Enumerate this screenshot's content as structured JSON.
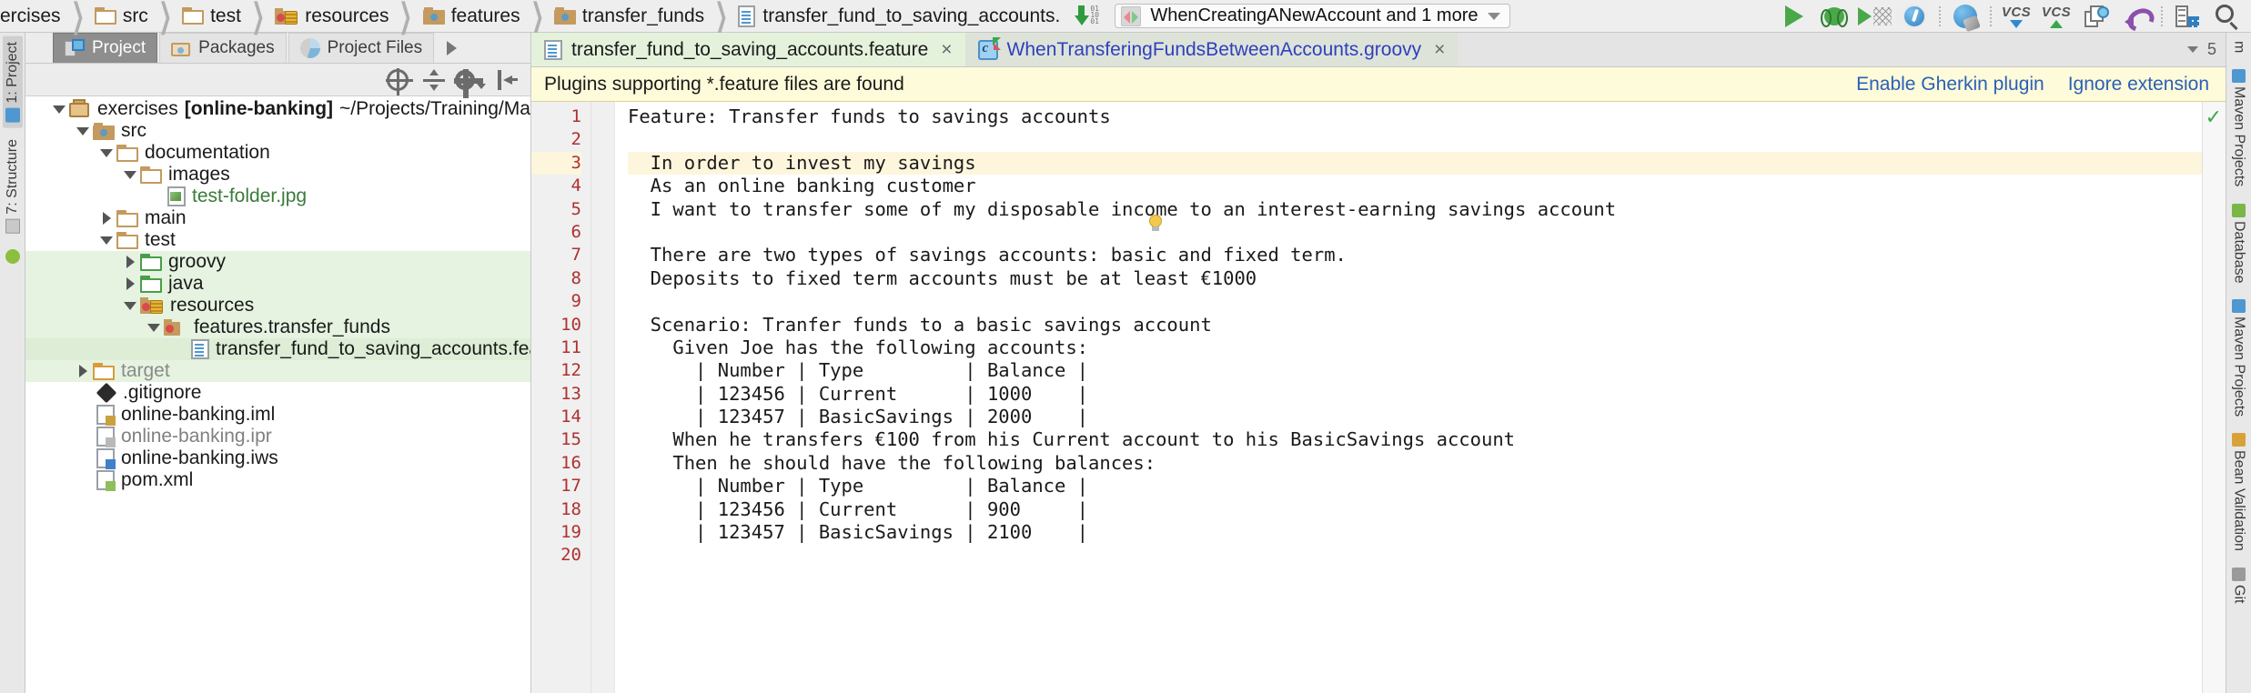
{
  "navbar": {
    "breadcrumbs": [
      {
        "label": "ercises",
        "icon": "none"
      },
      {
        "label": "src",
        "icon": "folder-plain-icon"
      },
      {
        "label": "test",
        "icon": "folder-plain-icon"
      },
      {
        "label": "resources",
        "icon": "resources-folder-icon"
      },
      {
        "label": "features",
        "icon": "folder-blue-icon"
      },
      {
        "label": "transfer_funds",
        "icon": "folder-blue-icon"
      },
      {
        "label": "transfer_fund_to_saving_accounts.",
        "icon": "feature-file-icon"
      }
    ],
    "download_bits": "01\n10\n01",
    "run_config": "WhenCreatingANewAccount and 1 more",
    "toolbar_icons": [
      "run-icon",
      "debug-icon",
      "coverage-icon",
      "profile-icon",
      "build-icon",
      "vcs-update-icon",
      "vcs-commit-icon",
      "vcs-history-icon",
      "undo-icon",
      "structure-icon",
      "search-icon"
    ]
  },
  "left_strip": {
    "tabs": [
      {
        "label": "1: Project",
        "icon": "project-icon",
        "selected": true
      },
      {
        "label": "7: Structure",
        "icon": "structure-icon",
        "selected": false
      },
      {
        "label": "",
        "icon": "ant-build-icon",
        "selected": false
      }
    ]
  },
  "right_strip": {
    "tabs": [
      {
        "label": "m",
        "icon": "maven-letter-icon"
      },
      {
        "label": "Maven Projects",
        "icon": "maven-icon"
      },
      {
        "label": "Database",
        "icon": "database-icon"
      },
      {
        "label": "Maven Projects",
        "icon": "maven-icon"
      },
      {
        "label": "Bean Validation",
        "icon": "bean-icon"
      },
      {
        "label": "Git",
        "icon": "git-icon"
      }
    ]
  },
  "project_panel": {
    "tabs": [
      {
        "label": "Project",
        "icon": "project-icon",
        "active": true
      },
      {
        "label": "Packages",
        "icon": "packages-icon",
        "active": false
      },
      {
        "label": "Project Files",
        "icon": "project-files-icon",
        "active": false
      }
    ],
    "more_tabs_icon": "chevron-right-icon",
    "toolbar_icons": [
      "scroll-from-source-icon",
      "collapse-all-icon",
      "settings-gear-icon",
      "hide-panel-icon"
    ],
    "tree": [
      {
        "indent": 0,
        "twisty": "down",
        "icon": "module-icon",
        "label": "exercises",
        "bold": true,
        "suffix": "[online-banking]",
        "path": "~/Projects/Training/Masterclass/e",
        "highlight": false
      },
      {
        "indent": 1,
        "twisty": "down",
        "icon": "folder-blue-icon",
        "label": "src",
        "highlight": false
      },
      {
        "indent": 2,
        "twisty": "down",
        "icon": "folder-plain-icon",
        "label": "documentation",
        "highlight": false
      },
      {
        "indent": 3,
        "twisty": "down",
        "icon": "folder-plain-icon",
        "label": "images",
        "highlight": false
      },
      {
        "indent": 4,
        "twisty": "none",
        "icon": "image-file-icon",
        "label": "test-folder.jpg",
        "green": true,
        "highlight": false
      },
      {
        "indent": 2,
        "twisty": "right",
        "icon": "folder-plain-icon",
        "label": "main",
        "highlight": false
      },
      {
        "indent": 2,
        "twisty": "down",
        "icon": "folder-plain-icon",
        "label": "test",
        "highlight": false
      },
      {
        "indent": 3,
        "twisty": "right",
        "icon": "folder-green-icon",
        "label": "groovy",
        "highlight": true
      },
      {
        "indent": 3,
        "twisty": "right",
        "icon": "folder-green-icon",
        "label": "java",
        "highlight": true
      },
      {
        "indent": 3,
        "twisty": "down",
        "icon": "resources-folder-icon",
        "label": "resources",
        "highlight": true
      },
      {
        "indent": 4,
        "twisty": "down",
        "icon": "package-icon",
        "label": "features.transfer_funds",
        "highlight": true
      },
      {
        "indent": 5,
        "twisty": "none",
        "icon": "feature-file-icon",
        "label": "transfer_fund_to_saving_accounts.feature",
        "highlight": true
      },
      {
        "indent": 2,
        "twisty": "right",
        "icon": "folder-orange-icon",
        "label": "target",
        "strike": true,
        "highlight": true
      },
      {
        "indent": 1,
        "twisty": "none",
        "icon": "git-icon",
        "label": ".gitignore",
        "highlight": false
      },
      {
        "indent": 1,
        "twisty": "none",
        "icon": "iml-file-icon",
        "label": "online-banking.iml",
        "highlight": false
      },
      {
        "indent": 1,
        "twisty": "none",
        "icon": "ipr-file-icon",
        "label": "online-banking.ipr",
        "dimmed": true,
        "highlight": false
      },
      {
        "indent": 1,
        "twisty": "none",
        "icon": "iws-file-icon",
        "label": "online-banking.iws",
        "highlight": false
      },
      {
        "indent": 1,
        "twisty": "none",
        "icon": "xml-file-icon",
        "label": "pom.xml",
        "highlight": false
      }
    ]
  },
  "editor": {
    "tabs": [
      {
        "label": "transfer_fund_to_saving_accounts.feature",
        "icon": "feature-file-icon",
        "active": true,
        "close": "×"
      },
      {
        "label": "WhenTransferingFundsBetweenAccounts.groovy",
        "icon": "groovy-file-icon",
        "active": false,
        "close": "×"
      }
    ],
    "tabs_right_label": "5",
    "notification": {
      "message": "Plugins supporting *.feature files are found",
      "links": [
        "Enable Gherkin plugin",
        "Ignore extension"
      ]
    },
    "lines": [
      {
        "n": 1,
        "text": "Feature: Transfer funds to savings accounts"
      },
      {
        "n": 2,
        "text": ""
      },
      {
        "n": 3,
        "text": "  In order to invest my savings",
        "current": true
      },
      {
        "n": 4,
        "text": "  As an online banking customer"
      },
      {
        "n": 5,
        "text": "  I want to transfer some of my disposable income to an interest-earning savings account"
      },
      {
        "n": 6,
        "text": ""
      },
      {
        "n": 7,
        "text": "  There are two types of savings accounts: basic and fixed term."
      },
      {
        "n": 8,
        "text": "  Deposits to fixed term accounts must be at least €1000"
      },
      {
        "n": 9,
        "text": ""
      },
      {
        "n": 10,
        "text": "  Scenario: Tranfer funds to a basic savings account"
      },
      {
        "n": 11,
        "text": "    Given Joe has the following accounts:"
      },
      {
        "n": 12,
        "text": "      | Number | Type         | Balance |"
      },
      {
        "n": 13,
        "text": "      | 123456 | Current      | 1000    |"
      },
      {
        "n": 14,
        "text": "      | 123457 | BasicSavings | 2000    |"
      },
      {
        "n": 15,
        "text": "    When he transfers €100 from his Current account to his BasicSavings account"
      },
      {
        "n": 16,
        "text": "    Then he should have the following balances:"
      },
      {
        "n": 17,
        "text": "      | Number | Type         | Balance |"
      },
      {
        "n": 18,
        "text": "      | 123456 | Current      | 900     |"
      },
      {
        "n": 19,
        "text": "      | 123457 | BasicSavings | 2100    |"
      },
      {
        "n": 20,
        "text": ""
      }
    ],
    "status_check": "✓"
  },
  "colors": {
    "accent_green": "#3aa84a",
    "link_blue": "#2b5fb8",
    "notif_bg": "#fdfbd9",
    "gutter_num": "#b03030",
    "tab_active_bg": "#e4f2dc",
    "tree_highlight": "#e5f3e0"
  }
}
